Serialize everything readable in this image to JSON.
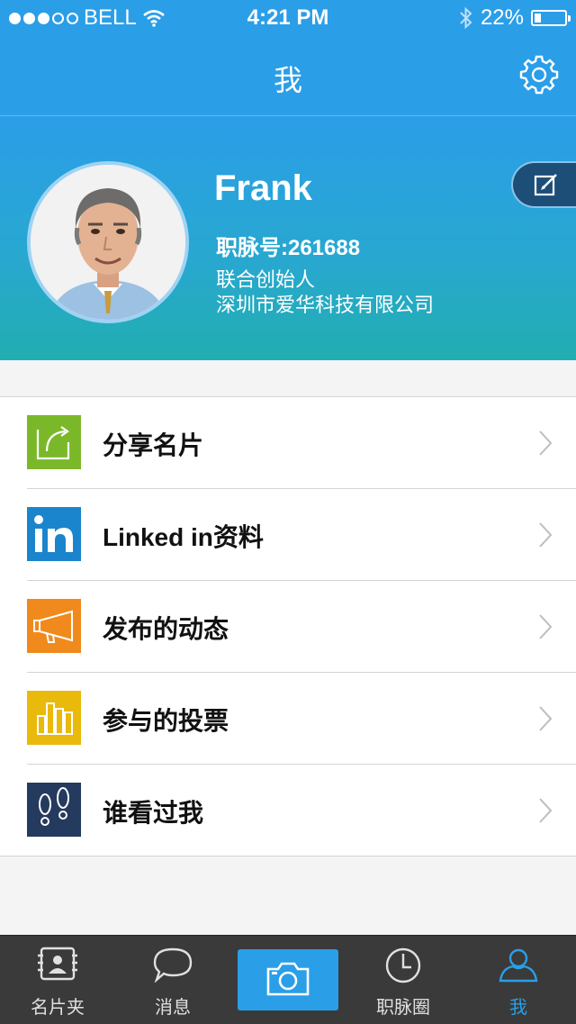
{
  "status_bar": {
    "carrier": "BELL",
    "time": "4:21 PM",
    "battery": "22%",
    "battery_level": 0.22,
    "signal_bars": 3
  },
  "nav": {
    "title": "我",
    "settings_icon": "gear-icon"
  },
  "profile": {
    "name": "Frank",
    "id_line": "职脉号:261688",
    "role": "联合创始人",
    "company": "深圳市爱华科技有限公司",
    "edit_icon": "edit-icon"
  },
  "menu": {
    "items": [
      {
        "label": "分享名片",
        "icon": "share-icon",
        "color": "#7ab829"
      },
      {
        "label": "Linked in资料",
        "icon": "linkedin-icon",
        "color": "#1a85cc"
      },
      {
        "label": "发布的动态",
        "icon": "megaphone-icon",
        "color": "#f08a1c"
      },
      {
        "label": "参与的投票",
        "icon": "bar-chart-icon",
        "color": "#e9b90c"
      },
      {
        "label": "谁看过我",
        "icon": "footprints-icon",
        "color": "#243a5e"
      }
    ]
  },
  "tabbar": {
    "tabs": [
      {
        "label": "名片夹",
        "icon": "card-holder-icon"
      },
      {
        "label": "消息",
        "icon": "chat-bubble-icon"
      },
      {
        "label": "",
        "icon": "camera-icon"
      },
      {
        "label": "职脉圈",
        "icon": "clock-icon"
      },
      {
        "label": "我",
        "icon": "person-icon",
        "active": true
      }
    ]
  },
  "colors": {
    "primary": "#2b9ee8",
    "tabbar_bg": "#3a3a3a"
  }
}
